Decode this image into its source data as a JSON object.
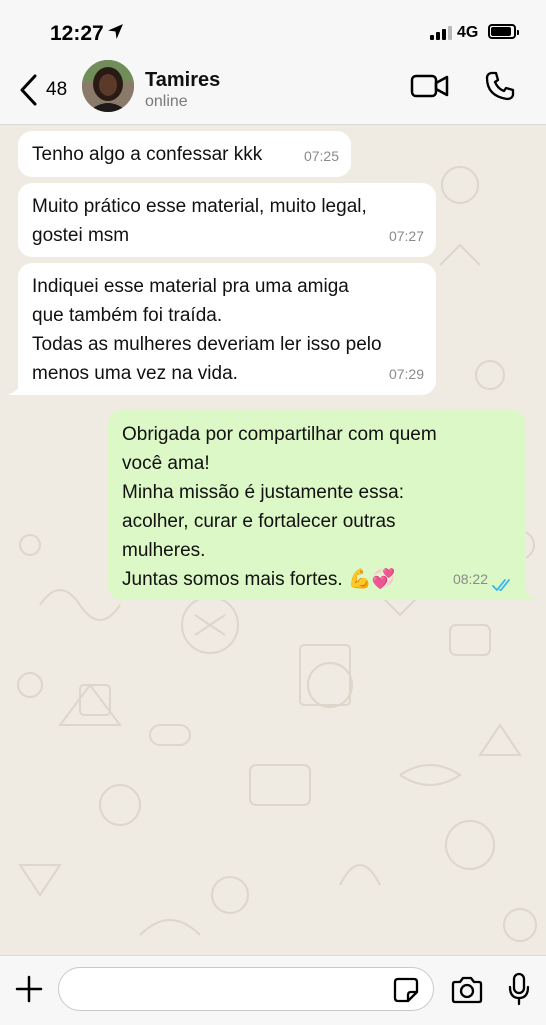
{
  "status_bar": {
    "time": "12:27",
    "network": "4G"
  },
  "header": {
    "back_count": "48",
    "contact_name": "Tamires",
    "contact_status": "online"
  },
  "messages": [
    {
      "direction": "in",
      "text": "Tenho algo a confessar kkk",
      "time": "07:25"
    },
    {
      "direction": "in",
      "text": "Muito prático esse material, muito legal,\ngostei msm",
      "time": "07:27"
    },
    {
      "direction": "in",
      "text": "Indiquei esse material pra uma amiga\nque também foi traída.\nTodas as mulheres deveriam ler isso pelo\nmenos uma vez na vida.",
      "time": "07:29"
    },
    {
      "direction": "out",
      "text": "Obrigada por compartilhar com quem\nvocê ama!\nMinha missão é justamente essa:\nacolher, curar e fortalecer outras\nmulheres.\nJuntas somos mais fortes. 💪💞",
      "time": "08:22",
      "status": "read"
    }
  ],
  "composer": {
    "placeholder": ""
  },
  "colors": {
    "chat_background": "#efeae2",
    "incoming_bubble": "#ffffff",
    "outgoing_bubble": "#dcf8c6",
    "read_ticks": "#34b7f1"
  }
}
